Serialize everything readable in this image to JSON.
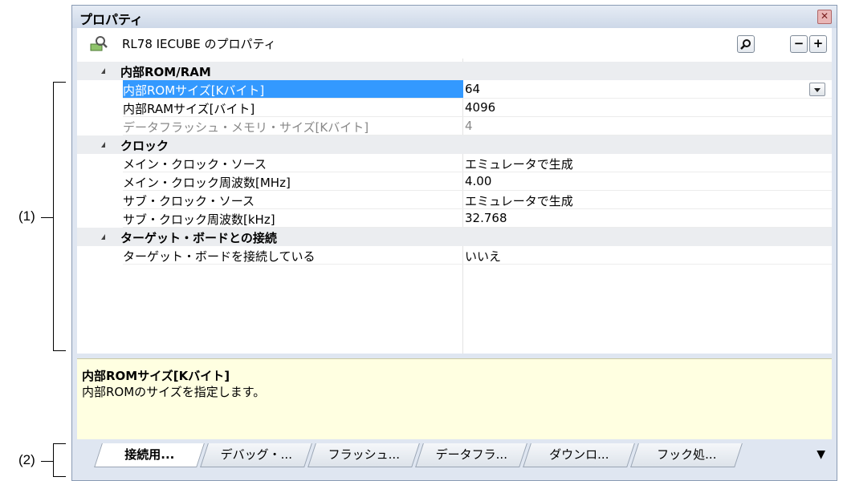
{
  "callouts": {
    "one": "(1)",
    "two": "(2)"
  },
  "panel": {
    "title": "プロパティ",
    "header_name": "RL78 IECUBE のプロパティ",
    "buttons": {
      "search": "🔍",
      "collapse": "−",
      "expand": "+"
    }
  },
  "categories": [
    {
      "label": "内部ROM/RAM",
      "rows": [
        {
          "label": "内部ROMサイズ[Kバイト]",
          "value": "64",
          "state": "selected"
        },
        {
          "label": "内部RAMサイズ[バイト]",
          "value": "4096",
          "state": "normal"
        },
        {
          "label": "データフラッシュ・メモリ・サイズ[Kバイト]",
          "value": "4",
          "state": "disabled"
        }
      ]
    },
    {
      "label": "クロック",
      "rows": [
        {
          "label": "メイン・クロック・ソース",
          "value": "エミュレータで生成",
          "state": "normal"
        },
        {
          "label": "メイン・クロック周波数[MHz]",
          "value": "4.00",
          "state": "normal"
        },
        {
          "label": "サブ・クロック・ソース",
          "value": "エミュレータで生成",
          "state": "normal"
        },
        {
          "label": "サブ・クロック周波数[kHz]",
          "value": "32.768",
          "state": "normal"
        }
      ]
    },
    {
      "label": "ターゲット・ボードとの接続",
      "rows": [
        {
          "label": "ターゲット・ボードを接続している",
          "value": "いいえ",
          "state": "normal"
        }
      ]
    }
  ],
  "description": {
    "title": "内部ROMサイズ[Kバイト]",
    "text": "内部ROMのサイズを指定します。"
  },
  "tabs": [
    "接続用...",
    "デバッグ・...",
    "フラッシュ...",
    "データフラ...",
    "ダウンロ...",
    "フック処..."
  ],
  "active_tab": 0
}
